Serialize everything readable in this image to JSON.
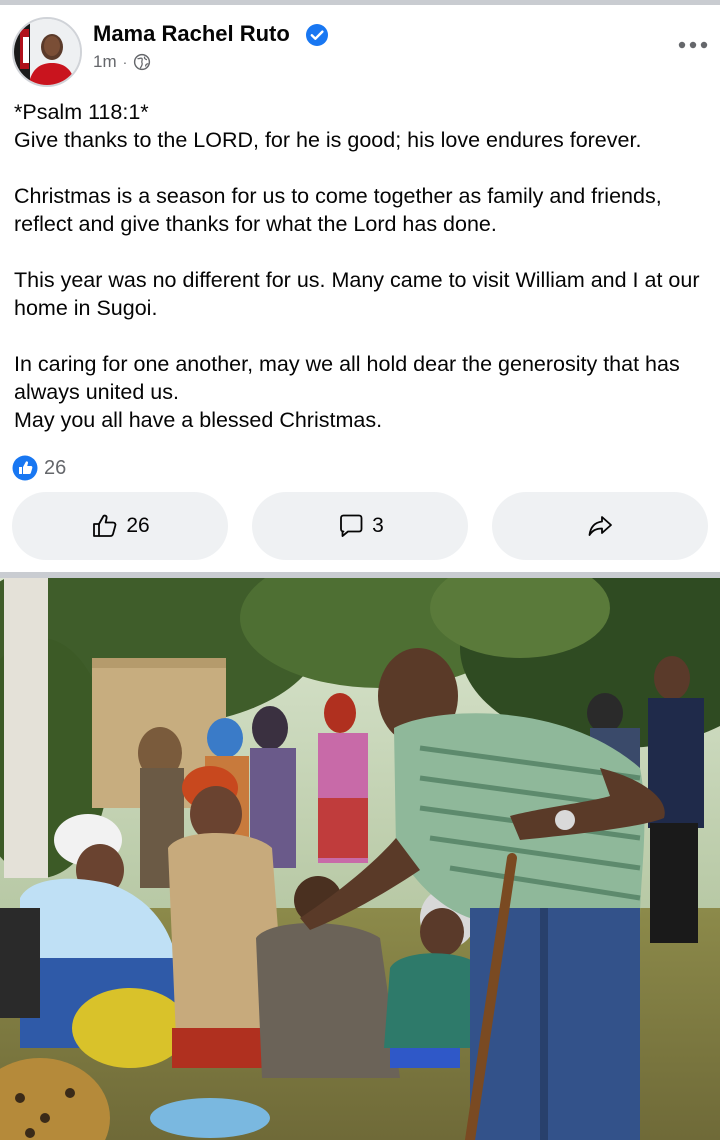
{
  "post": {
    "author": "Mama Rachel Ruto",
    "time": "1m",
    "separator": "·",
    "text": "*Psalm 118:1*\nGive thanks to the LORD, for he is good; his love endures forever.\n\nChristmas is a season for us to come together as family and friends, reflect and give thanks for what the Lord has done.\n\nThis year was no different for us. Many came to visit William and I at our home in Sugoi.\n\nIn caring for one another, may we all hold dear the generosity that has always united us.\nMay you all have a blessed Christmas.",
    "reaction_count": "26",
    "like_count": "26",
    "comment_count": "3"
  },
  "icons": {
    "verified": "verified-badge-icon",
    "audience": "globe-icon",
    "more": "more-options-icon",
    "like_bubble": "like-reaction-icon",
    "like": "thumbs-up-icon",
    "comment": "comment-icon",
    "share": "share-icon"
  },
  "colors": {
    "brand_blue": "#1877f2",
    "secondary_text": "#65676b",
    "button_bg": "#eff1f3",
    "divider": "#c9ccd1"
  }
}
